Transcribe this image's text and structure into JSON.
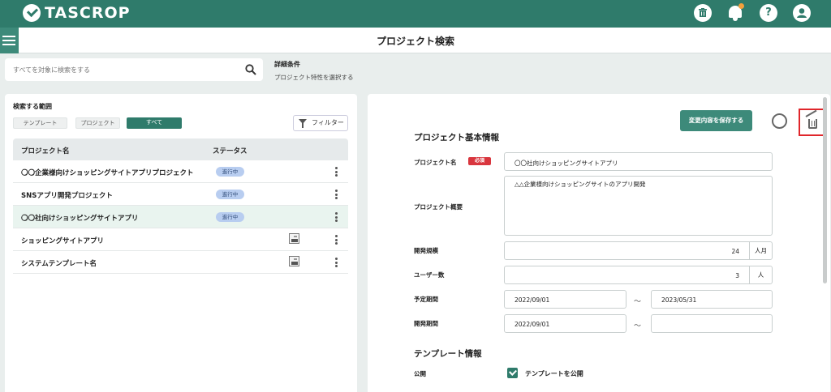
{
  "app": {
    "name": "TASCROP"
  },
  "header_icons": [
    "trash-icon",
    "bell-icon",
    "help-icon",
    "user-icon"
  ],
  "header": {
    "help_label": "?",
    "page_title": "プロジェクト検索"
  },
  "search": {
    "placeholder": "すべてを対象に検索をする",
    "detail_title": "詳細条件",
    "detail_sub": "プロジェクト特性を選択する"
  },
  "scope": {
    "label": "検索する範囲",
    "options": [
      "テンプレート",
      "プロジェクト",
      "すべて"
    ],
    "selected": "すべて",
    "filter_label": "フィルター"
  },
  "table": {
    "headers": [
      "プロジェクト名",
      "ステータス"
    ],
    "rows": [
      {
        "name": "〇〇企業様向けショッピングサイトアプリプロジェクト",
        "status": "進行中"
      },
      {
        "name": "SNSアプリ開発プロジェクト",
        "status": "進行中"
      },
      {
        "name": "〇〇社向けショッピングサイトアプリ",
        "status": "進行中",
        "selected": true
      },
      {
        "name": "ショッピングサイトアプリ",
        "type": "template"
      },
      {
        "name": "システムテンプレート名",
        "type": "template"
      }
    ]
  },
  "detail": {
    "save_label": "変更内容を保存する",
    "basic_title": "プロジェクト基本情報",
    "name_label": "プロジェクト名",
    "required": "必須",
    "name_value": "〇〇社向けショッピングサイトアプリ",
    "summary_label": "プロジェクト概要",
    "summary_value": "△△企業様向けショッピングサイトのアプリ開発",
    "scale_label": "開発規模",
    "scale_value": "24",
    "scale_unit": "人月",
    "users_label": "ユーザー数",
    "users_value": "3",
    "users_unit": "人",
    "planned_label": "予定期間",
    "planned_start": "2022/09/01",
    "planned_end": "2023/05/31",
    "dev_label": "開発期間",
    "dev_start": "2022/09/01",
    "dev_end": "",
    "tilde": "～",
    "template_title": "テンプレート情報",
    "public_label": "公開",
    "public_check_label": "テンプレートを公開",
    "public_checked": true
  },
  "colors": {
    "brand": "#2f7b6b",
    "badge": "#b8cdf0",
    "required": "#d9363e",
    "highlight": "#e0262b"
  }
}
